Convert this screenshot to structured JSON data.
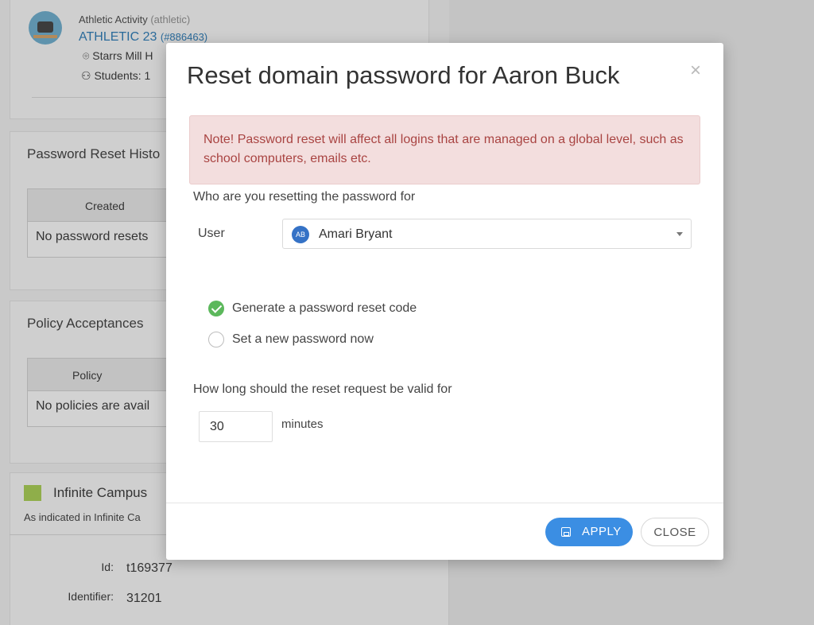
{
  "background": {
    "activity": {
      "type": "Athletic Activity",
      "type_code": "(athletic)",
      "name": "ATHLETIC 23",
      "id": "(#886463)",
      "location": "Starrs Mill H",
      "students": "Students: 1"
    },
    "password_reset_history": {
      "title": "Password Reset Histo",
      "column": "Created",
      "empty": "No password resets"
    },
    "policy_acceptances": {
      "title": "Policy Acceptances",
      "column": "Policy",
      "empty": "No policies are avail"
    },
    "infinite_campus": {
      "title": "Infinite Campus",
      "subtitle": "As indicated in Infinite Ca",
      "fields": [
        {
          "label": "Id:",
          "value": "t169377"
        },
        {
          "label": "Identifier:",
          "value": "31201"
        }
      ]
    }
  },
  "modal": {
    "title": "Reset domain password for Aaron Buck",
    "close_glyph": "×",
    "alert": "Note! Password reset will affect all logins that are managed on a global level, such as school computers, emails etc.",
    "who_question": "Who are you resetting the password for",
    "user_label": "User",
    "user": {
      "initials": "AB",
      "name": "Amari Bryant"
    },
    "options": [
      {
        "label": "Generate a password reset code",
        "selected": true
      },
      {
        "label": "Set a new password now",
        "selected": false
      }
    ],
    "valid_question": "How long should the reset request be valid for",
    "minutes_value": "30",
    "minutes_label": "minutes",
    "apply_label": "APPLY",
    "close_label": "CLOSE"
  },
  "colors": {
    "accent": "#3b8ee3",
    "alert_bg": "#f3dede",
    "alert_text": "#a94442",
    "success": "#5cb85c",
    "link": "#2a6a9a"
  }
}
